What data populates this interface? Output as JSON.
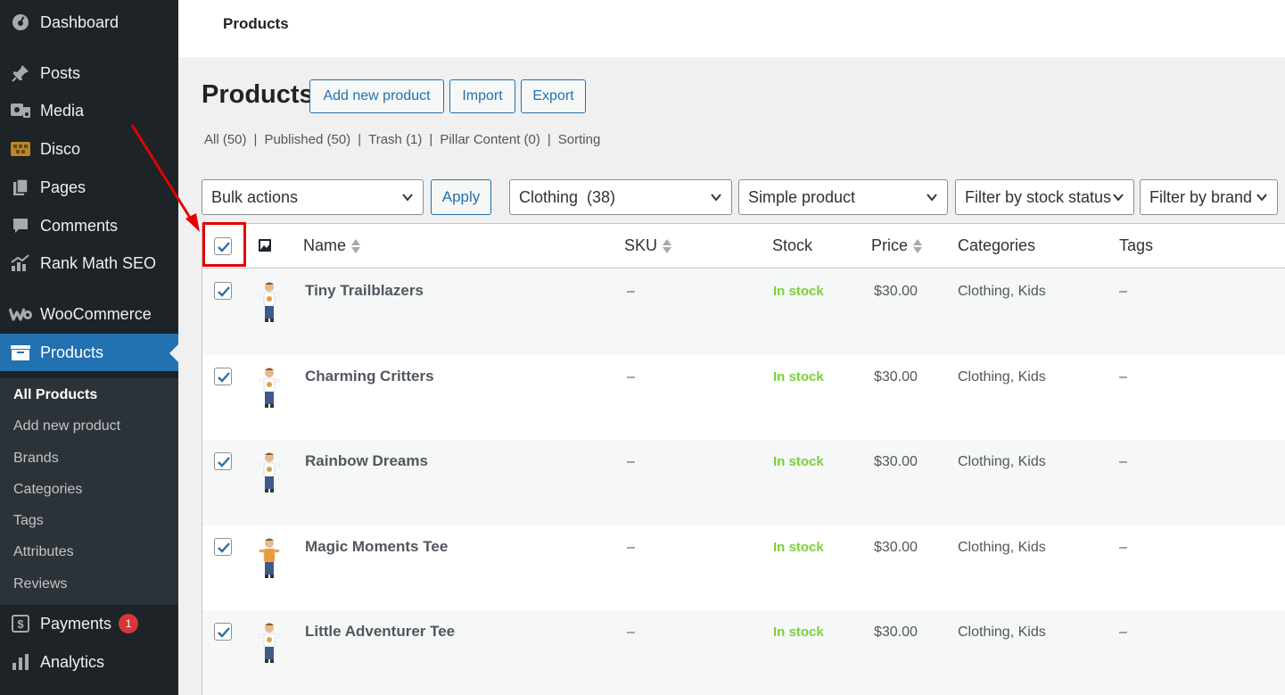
{
  "sidebar": {
    "menu": [
      {
        "label": "Dashboard",
        "icon": "dashboard-icon"
      },
      {
        "label": "Posts",
        "icon": "pin-icon"
      },
      {
        "label": "Media",
        "icon": "media-icon"
      },
      {
        "label": "Disco",
        "icon": "disco-icon"
      },
      {
        "label": "Pages",
        "icon": "pages-icon"
      },
      {
        "label": "Comments",
        "icon": "comment-icon"
      },
      {
        "label": "Rank Math SEO",
        "icon": "chart-icon"
      },
      {
        "label": "WooCommerce",
        "icon": "woo-icon"
      },
      {
        "label": "Products",
        "icon": "archive-icon"
      },
      {
        "label": "Payments",
        "icon": "dollar-icon",
        "badge": "1"
      },
      {
        "label": "Analytics",
        "icon": "bar-chart-icon"
      }
    ],
    "submenu": [
      "All Products",
      "Add new product",
      "Brands",
      "Categories",
      "Tags",
      "Attributes",
      "Reviews"
    ]
  },
  "topbar": {
    "title": "Products"
  },
  "header": {
    "title": "Products",
    "buttons": [
      "Add new product",
      "Import",
      "Export"
    ]
  },
  "views": [
    {
      "label": "All",
      "count": "(50)"
    },
    {
      "label": "Published",
      "count": "(50)"
    },
    {
      "label": "Trash",
      "count": "(1)"
    },
    {
      "label": "Pillar Content",
      "count": "(0)"
    },
    {
      "label": "Sorting",
      "count": ""
    }
  ],
  "filters": {
    "bulk_actions": "Bulk actions",
    "apply": "Apply",
    "category": "Clothing  (38)",
    "product_type": "Simple product",
    "stock_status": "Filter by stock status",
    "brand": "Filter by brand"
  },
  "table": {
    "columns": {
      "name": "Name",
      "sku": "SKU",
      "stock": "Stock",
      "price": "Price",
      "categories": "Categories",
      "tags": "Tags"
    },
    "rows": [
      {
        "name": "Tiny Trailblazers",
        "sku": "–",
        "stock": "In stock",
        "price": "$30.00",
        "categories": "Clothing, Kids",
        "tags": "–",
        "shirt_color": "#ffffff"
      },
      {
        "name": "Charming Critters",
        "sku": "–",
        "stock": "In stock",
        "price": "$30.00",
        "categories": "Clothing, Kids",
        "tags": "–",
        "shirt_color": "#ffffff"
      },
      {
        "name": "Rainbow Dreams",
        "sku": "–",
        "stock": "In stock",
        "price": "$30.00",
        "categories": "Clothing, Kids",
        "tags": "–",
        "shirt_color": "#ffffff"
      },
      {
        "name": "Magic Moments Tee",
        "sku": "–",
        "stock": "In stock",
        "price": "$30.00",
        "categories": "Clothing, Kids",
        "tags": "–",
        "shirt_color": "#f29a2e"
      },
      {
        "name": "Little Adventurer Tee",
        "sku": "–",
        "stock": "In stock",
        "price": "$30.00",
        "categories": "Clothing, Kids",
        "tags": "–",
        "shirt_color": "#ffffff"
      }
    ]
  },
  "colors": {
    "accent": "#2271b1",
    "sidebar": "#1d2327",
    "in_stock": "#7ad03a",
    "annotation": "#e60000"
  }
}
